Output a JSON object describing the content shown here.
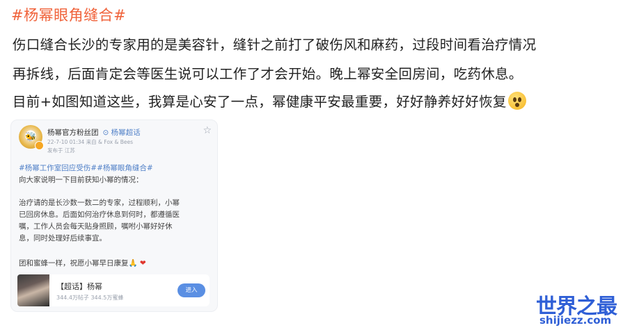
{
  "post": {
    "hashtag_title": "#杨幂眼角缝合#",
    "line1": "伤口缝合长沙的专家用的是美容针，缝针之前打了破伤风和麻药，过段时间看治疗情况",
    "line2": "再拆线，后面肯定会等医生说可以工作了才会开始。晚上幂安全回房间，吃药休息。",
    "line3": "目前+如图知道这些，我算是心安了一点，幂健康平安最重要，好好静养好好恢复",
    "emoji_icon": "pleading-face-icon"
  },
  "card": {
    "account_name": "杨幂官方粉丝团",
    "account_tag": "杨幂超话",
    "meta": "22-7-10 01:34 来自 & Fox & Bees",
    "location": "发布于 江苏",
    "hashtags": "#杨幂工作室回应受伤##杨幂眼角缝合#",
    "line1": "向大家说明一下目前获知小幂的情况：",
    "line2": "治疗请的是长沙数一数二的专家，过程顺利，小幂",
    "line3": "已回房休息。后面如何治疗休息到何时，都遵循医",
    "line4": "嘱，工作人员会每天贴身照顾，嘱咐小幂好好休",
    "line5": "息，同时处理好后续事宜。",
    "line6": "团和蜜蜂一样，祝愿小幂早日康复🙏",
    "topic_title": "【超话】杨幂",
    "topic_stats": "344.4万帖子 344.5万蜜蜂",
    "enter_label": "进入"
  },
  "watermark": {
    "logo": "世界之最",
    "url": "shijiezz.com"
  },
  "colors": {
    "hashtag": "#f0623a",
    "link": "#4f7fc7",
    "button": "#5a8fe3",
    "watermark": "#2f5fd6"
  }
}
